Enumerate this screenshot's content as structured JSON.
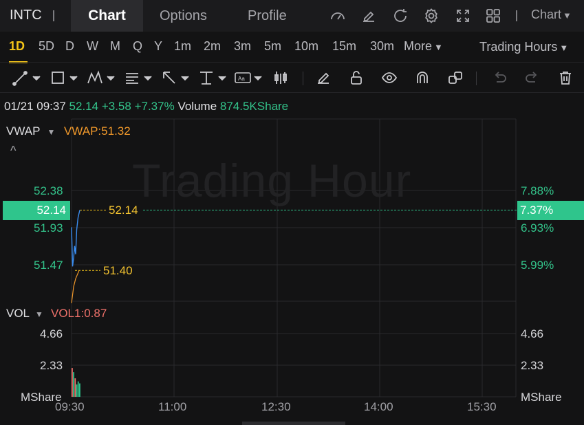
{
  "header": {
    "ticker": "INTC",
    "tabs": [
      "Chart",
      "Options",
      "Profile"
    ],
    "active_tab": "Chart",
    "chart_dropdown": "Chart",
    "icons": [
      "speedometer-icon",
      "edit-icon",
      "refresh-icon",
      "settings-icon",
      "fullscreen-icon",
      "layout-grid-icon"
    ]
  },
  "timeframes": {
    "items": [
      "1D",
      "5D",
      "D",
      "W",
      "M",
      "Q",
      "Y",
      "1m",
      "2m",
      "3m",
      "5m",
      "10m",
      "15m",
      "30m"
    ],
    "active": "1D",
    "more_label": "More",
    "trading_hours_label": "Trading Hours"
  },
  "drawing_tools": [
    "trendline-icon",
    "rectangle-icon",
    "pattern-icon",
    "fib-icon",
    "arrow-icon",
    "text-cursor-icon",
    "label-icon",
    "candle-icon",
    "pencil-icon",
    "unlock-icon",
    "eye-icon",
    "magnet-icon",
    "duplicate-icon",
    "undo-icon",
    "redo-icon",
    "trash-icon"
  ],
  "info": {
    "datetime": "01/21 09:37",
    "price": "52.14",
    "change": "+3.58",
    "change_pct": "+7.37%",
    "volume_label": "Volume",
    "volume_value": "874.5KShare"
  },
  "vwap_pane": {
    "name": "VWAP",
    "value_label": "VWAP:51.32",
    "collapse_glyph": "^",
    "watermark": "Trading Hour",
    "left_labels": [
      "52.38",
      "51.93",
      "51.47"
    ],
    "right_labels": [
      "7.88%",
      "6.93%",
      "5.99%"
    ],
    "current_price_left": "52.14",
    "current_price_right": "7.37%",
    "price_line_label": "52.14",
    "vwap_line_label": "51.40"
  },
  "vol_pane": {
    "name": "VOL",
    "value_label": "VOL1:0.87",
    "left_labels": [
      "4.66",
      "2.33",
      "MShare"
    ],
    "right_labels": [
      "4.66",
      "2.33",
      "MShare"
    ]
  },
  "x_axis": [
    "09:30",
    "11:00",
    "12:30",
    "14:00",
    "15:30"
  ],
  "colors": {
    "up": "#2fc58c",
    "down": "#f0726b",
    "accent": "#f5c518",
    "vwap": "#f39a2b",
    "price_line": "#3a8df0",
    "background": "#131314"
  },
  "chart_data": {
    "type": "line",
    "x_axis_labels": [
      "09:30",
      "11:00",
      "12:30",
      "14:00",
      "15:30"
    ],
    "price_series": {
      "x": [
        "09:30",
        "09:31",
        "09:32",
        "09:33",
        "09:34",
        "09:35",
        "09:36",
        "09:37"
      ],
      "values": [
        51.93,
        51.45,
        51.55,
        51.7,
        51.6,
        51.9,
        52.05,
        52.14
      ]
    },
    "vwap_series": {
      "x": [
        "09:30",
        "09:32",
        "09:34",
        "09:37"
      ],
      "values": [
        51.0,
        51.2,
        51.3,
        51.4
      ]
    },
    "volume_bars": {
      "unit": "MShare",
      "values": [
        1.87,
        1.6,
        1.2,
        0.8,
        1.0,
        0.87
      ],
      "directions": [
        "down",
        "up",
        "down",
        "up",
        "up",
        "up"
      ]
    },
    "price_ylim": [
      51.0,
      52.6
    ],
    "volume_ylim": [
      0,
      6.2
    ]
  }
}
